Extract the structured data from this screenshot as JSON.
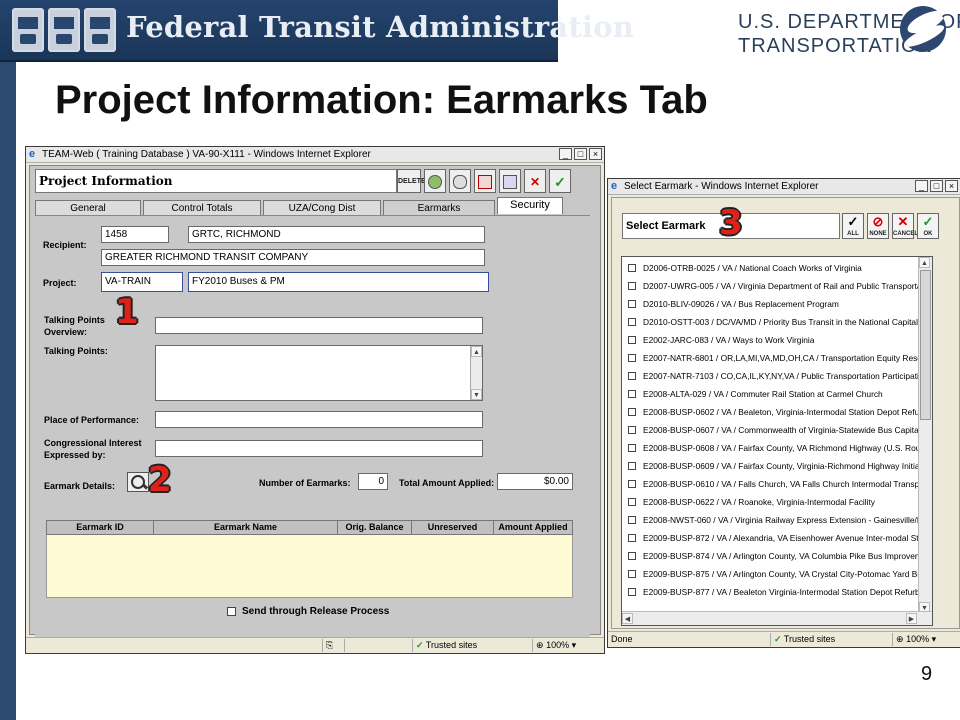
{
  "banner": {
    "agency": "Federal Transit Administration",
    "dot_line1": "U.S. DEPARTMENT OF",
    "dot_line2": "TRANSPORTATION"
  },
  "slide": {
    "title": "Project Information:  Earmarks Tab",
    "page_number": "9"
  },
  "project_window": {
    "title": "TEAM-Web ( Training Database ) VA-90-X111 - Windows Internet Explorer",
    "heading": "Project Information",
    "toolbar": {
      "delete": "DELETE",
      "cancel": "CANCEL",
      "ok": "OK"
    },
    "tabs": [
      "General",
      "Control Totals",
      "UZA/Cong Dist",
      "Earmarks",
      "Security"
    ],
    "fields": {
      "recipient_label": "Recipient:",
      "recipient_id": "1458",
      "recipient_name": "GRTC, RICHMOND",
      "recipient_full": "GREATER RICHMOND TRANSIT COMPANY",
      "project_label": "Project:",
      "project_id": "VA-TRAIN",
      "project_name": "FY2010 Buses & PM",
      "tp_overview_label_1": "Talking Points",
      "tp_overview_label_2": "Overview:",
      "talking_points_label": "Talking Points:",
      "place_label": "Place of Performance:",
      "cong_label_1": "Congressional Interest",
      "cong_label_2": "Expressed by:",
      "earmark_details_label": "Earmark Details:",
      "num_earmarks_label": "Number of Earmarks:",
      "num_earmarks_value": "0",
      "total_amount_label": "Total Amount Applied:",
      "total_amount_value": "$0.00",
      "release_label": "Send through Release Process"
    },
    "grid_columns": [
      "Earmark ID",
      "Earmark Name",
      "Orig. Balance",
      "Unreserved",
      "Amount Applied"
    ],
    "status": {
      "zone": "Trusted sites",
      "zoom": "100%"
    }
  },
  "callouts": {
    "one": "1",
    "two": "2",
    "three": "3"
  },
  "select_window": {
    "title": "Select Earmark - Windows Internet Explorer",
    "heading": "Select Earmark",
    "toolbar": {
      "all": "ALL",
      "none": "NONE",
      "cancel": "CANCEL",
      "ok": "OK"
    },
    "items": [
      "D2006-OTRB-0025 / VA / National Coach Works of Virginia",
      "D2007-UWRG-005 / VA / Virginia Department of Rail and Public Transporta",
      "D2010-BLIV-09026 / VA / Bus Replacement Program",
      "D2010-OSTT-003 / DC/VA/MD / Priority Bus Transit in the National Capital",
      "E2002-JARC-083 / VA / Ways to Work Virginia",
      "E2007-NATR-6801 / OR,LA,MI,VA,MD,OH,CA / Transportation Equity Rese",
      "E2007-NATR-7103 / CO,CA,IL,KY,NY,VA / Public Transportation Participati",
      "E2008-ALTA-029 / VA / Commuter Rail Station at Carmel Church",
      "E2008-BUSP-0602 / VA / Bealeton, Virginia-Intermodal Station Depot Refurb",
      "E2008-BUSP-0607 / VA / Commonwealth of Virginia-Statewide Bus Capital F",
      "E2008-BUSP-0608 / VA / Fairfax County, VA Richmond Highway (U.S. Rou",
      "E2008-BUSP-0609 / VA / Fairfax County, Virginia-Richmond Highway Initiati",
      "E2008-BUSP-0610 / VA / Falls Church, VA Falls Church Intermodal Transpo",
      "E2008-BUSP-0622 / VA / Roanoke, Virginia-Intermodal Facility",
      "E2008-NWST-060 / VA / Virginia Railway Express Extension - Gainesville/H",
      "E2009-BUSP-872 / VA / Alexandria, VA Eisenhower Avenue Inter-modal Sta",
      "E2009-BUSP-874 / VA / Arlington County, VA Columbia Pike Bus Improvem",
      "E2009-BUSP-875 / VA / Arlington County, VA Crystal City-Potomac Yard Bu",
      "E2009-BUSP-877 / VA / Bealeton Virginia-Intermodal Station Depot Refurbi"
    ],
    "status": {
      "done": "Done",
      "zone": "Trusted sites",
      "zoom": "100%"
    }
  }
}
